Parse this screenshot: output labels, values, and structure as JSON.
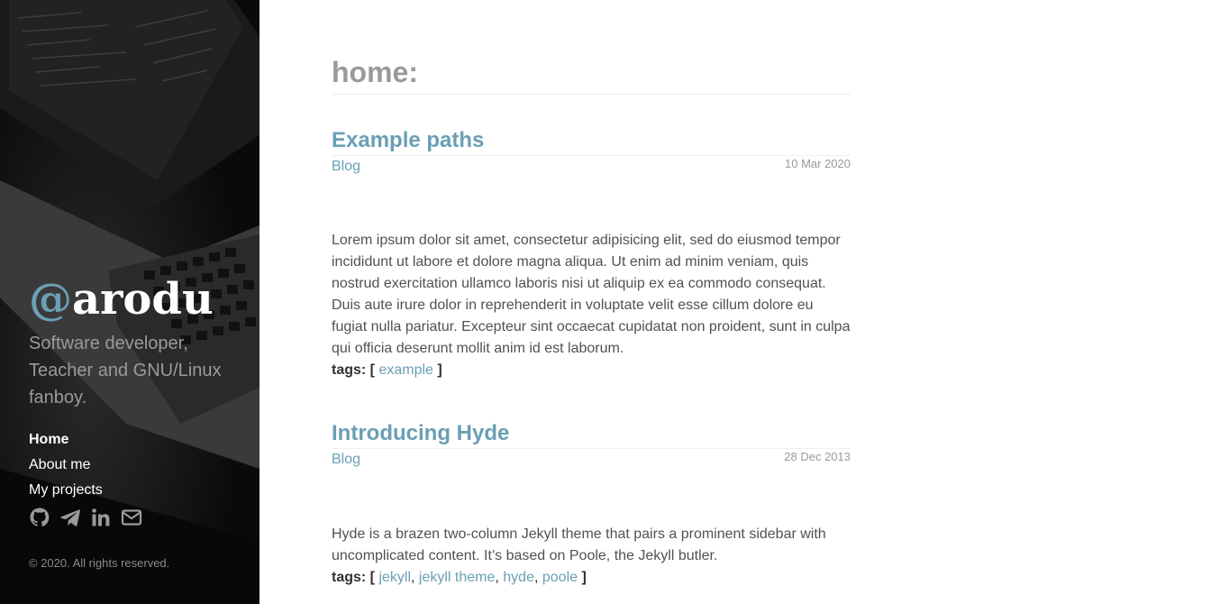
{
  "sidebar": {
    "brand_at": "@",
    "brand_name": "arodu",
    "lead": "Software developer, Teacher and GNU/Linux fanboy.",
    "nav": [
      {
        "label": "Home",
        "active": true
      },
      {
        "label": "About me",
        "active": false
      },
      {
        "label": "My projects",
        "active": false
      }
    ],
    "social_icons": [
      "github-icon",
      "telegram-icon",
      "linkedin-icon",
      "envelope-icon"
    ],
    "copyright": "© 2020. All rights reserved."
  },
  "main": {
    "title": "home:",
    "posts": [
      {
        "title": "Example paths",
        "category": "Blog",
        "date": "10 Mar 2020",
        "excerpt": "Lorem ipsum dolor sit amet, consectetur adipisicing elit, sed do eiusmod tempor incididunt ut labore et dolore magna aliqua. Ut enim ad minim veniam, quis nostrud exercitation ullamco laboris nisi ut aliquip ex ea commodo consequat. Duis aute irure dolor in reprehenderit in voluptate velit esse cillum dolore eu fugiat nulla pariatur. Excepteur sint occaecat cupidatat non proident, sunt in culpa qui officia deserunt mollit anim id est laborum.",
        "tags_label": "tags: [",
        "tags_close": "]",
        "tags": [
          "example"
        ]
      },
      {
        "title": "Introducing Hyde",
        "category": "Blog",
        "date": "28 Dec 2013",
        "excerpt": "Hyde is a brazen two-column Jekyll theme that pairs a prominent sidebar with uncomplicated content. It’s based on Poole, the Jekyll butler.",
        "tags_label": "tags: [",
        "tags_close": "]",
        "tags": [
          "jekyll",
          "jekyll theme",
          "hyde",
          "poole"
        ]
      }
    ]
  },
  "colors": {
    "accent": "#6a9fb5",
    "sidebar_bg": "#0c0c0c",
    "muted": "#9a9a9a",
    "text": "#515151"
  }
}
